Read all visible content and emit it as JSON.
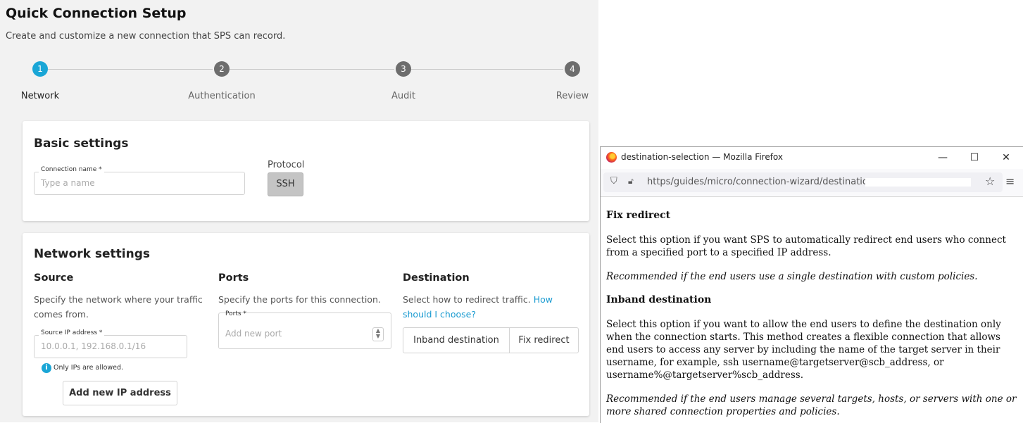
{
  "page": {
    "title": "Quick Connection Setup",
    "subtitle": "Create and customize a new connection that SPS can record."
  },
  "stepper": {
    "steps": [
      {
        "number": "1",
        "label": "Network",
        "state": "active"
      },
      {
        "number": "2",
        "label": "Authentication",
        "state": "pending"
      },
      {
        "number": "3",
        "label": "Audit",
        "state": "pending"
      },
      {
        "number": "4",
        "label": "Review",
        "state": "pending"
      }
    ]
  },
  "basic_settings": {
    "title": "Basic settings",
    "connection_name": {
      "label": "Connection name *",
      "placeholder": "Type a name",
      "value": ""
    },
    "protocol": {
      "label": "Protocol",
      "value": "SSH"
    }
  },
  "network_settings": {
    "title": "Network settings",
    "source": {
      "heading": "Source",
      "description": "Specify the network where your traffic comes from.",
      "ip_field": {
        "label": "Source IP address *",
        "placeholder": "10.0.0.1, 192.168.0.1/16",
        "value": ""
      },
      "hint": "Only IPs are allowed.",
      "add_button": "Add new IP address"
    },
    "ports": {
      "heading": "Ports",
      "description": "Specify the ports for this connection.",
      "ports_field": {
        "label": "Ports *",
        "placeholder": "Add new port",
        "value": ""
      }
    },
    "destination": {
      "heading": "Destination",
      "description": "Select how to redirect traffic.",
      "help_link": "How should I choose?",
      "options": [
        "Inband destination",
        "Fix redirect"
      ]
    }
  },
  "browser": {
    "window_title": "destination-selection — Mozilla Firefox",
    "url": "https/guides/micro/connection-wizard/destination",
    "content": {
      "fix_redirect_heading": "Fix redirect",
      "fix_redirect_text": "Select this option if you want SPS to automatically redirect end users who connect from a specified port to a specified IP address.",
      "fix_redirect_note": "Recommended if the end users use a single destination with custom policies.",
      "inband_heading": "Inband destination",
      "inband_text": "Select this option if you want to allow the end users to define the destination only when the connection starts. This method creates a flexible connection that allows end users to access any server by including the name of the target server in their username, for example, ssh username@targetserver@scb_address, or username%@targetserver%scb_address.",
      "inband_note": "Recommended if the end users manage several targets, hosts, or servers with one or more shared connection properties and policies."
    }
  },
  "colors": {
    "accent": "#1aa6d6",
    "step_pending": "#6d6d6d",
    "background": "#f2f2f2"
  }
}
